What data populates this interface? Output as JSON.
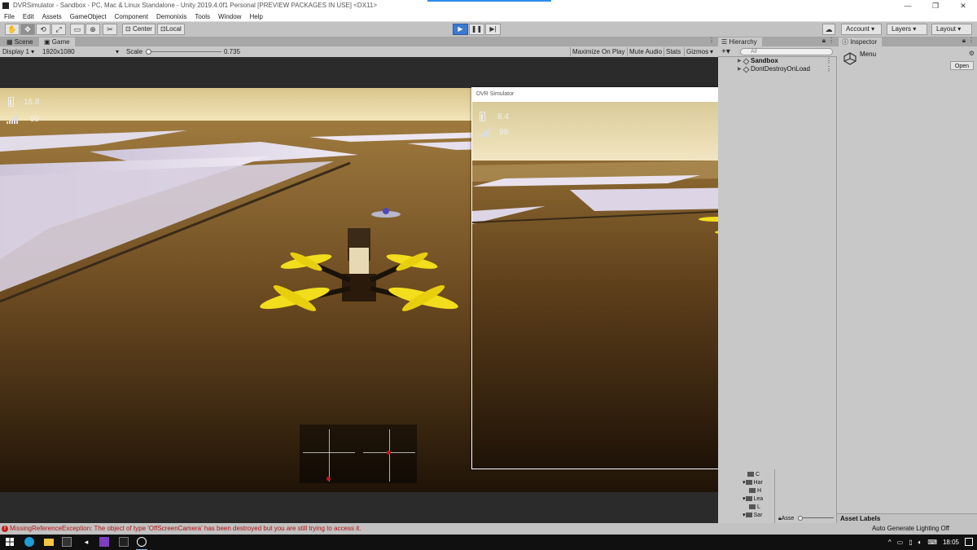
{
  "window": {
    "title": "DVRSimulator - Sandbox - PC, Mac & Linux Standalone - Unity 2019.4.0f1 Personal [PREVIEW PACKAGES IN USE] <DX11>",
    "minimize": "—",
    "maximize": "❐",
    "close": "✕"
  },
  "menu": [
    "File",
    "Edit",
    "Assets",
    "GameObject",
    "Component",
    "Demonixis",
    "Tools",
    "Window",
    "Help"
  ],
  "toolbar": {
    "pivot_label": "Center",
    "space_label": "Local",
    "account_label": "Account",
    "layers_label": "Layers",
    "layout_label": "Layout"
  },
  "game_tabs": {
    "scene_label": "Scene",
    "game_label": "Game"
  },
  "game_bar": {
    "display": "Display 1",
    "resolution": "1920x1080",
    "scale_label": "Scale",
    "scale_value": "0.735",
    "maximize_on_play": "Maximize On Play",
    "mute_audio": "Mute Audio",
    "stats": "Stats",
    "gizmos": "Gizmos"
  },
  "main_hud": {
    "battery": "16.8",
    "signal": "99"
  },
  "dvr_window": {
    "title": "DVR Simulator",
    "battery": "8.4",
    "signal": "99"
  },
  "hierarchy": {
    "tab_label": "Hierarchy",
    "search_placeholder": "All",
    "items": [
      {
        "label": "Sandbox"
      },
      {
        "label": "DontDestroyOnLoad"
      }
    ]
  },
  "inspector": {
    "tab_label": "Inspector",
    "object_name": "Menu",
    "open_button": "Open"
  },
  "project": {
    "tree": [
      "C",
      "Har",
      "H",
      "Lea",
      "L",
      "Sar"
    ],
    "zoom_label": "Asse",
    "asset_labels": "Asset Labels"
  },
  "status": {
    "error": "MissingReferenceException: The object of type 'OffScreenCamera' has been destroyed but you are still trying to access it.",
    "right": "Auto Generate Lighting Off"
  },
  "taskbar": {
    "time": "18:05"
  },
  "colors": {
    "play_active": "#3c79d1",
    "error_red": "#b01313",
    "prop_yellow": "#f2de1c",
    "stick_dot": "#c41717"
  }
}
